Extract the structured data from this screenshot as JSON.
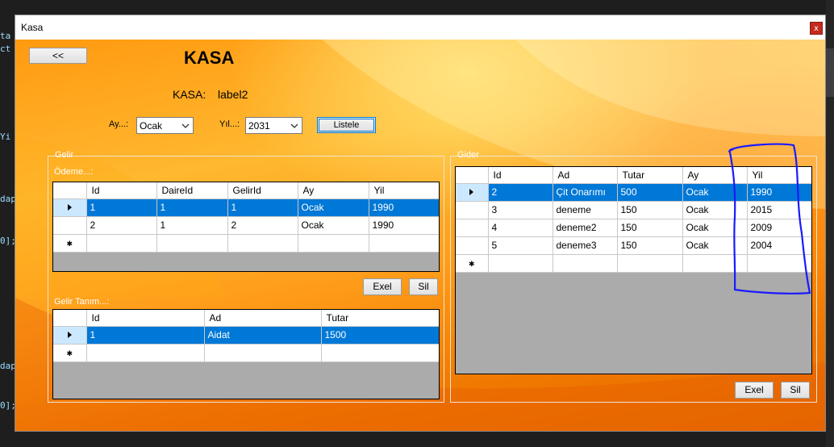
{
  "background_code": {
    "lines": [
      "ta",
      "ct",
      "Yi",
      "dap",
      "0];",
      "dap",
      "0];"
    ]
  },
  "window": {
    "title": "Kasa",
    "close_glyph": "x"
  },
  "header": {
    "back_button": "<<",
    "heading": "KASA",
    "kasa_label": "KASA:",
    "kasa_value": "label2"
  },
  "filter": {
    "ay_label": "Ay...:",
    "ay_value": "Ocak",
    "yil_label": "Yıl...:",
    "yil_value": "2031",
    "list_button": "Listele"
  },
  "gelir": {
    "group_title": "Gelir",
    "odeme_label": "Ödeme...:",
    "odeme_columns": [
      "Id",
      "DaireId",
      "GelirId",
      "Ay",
      "Yil"
    ],
    "odeme_rows": [
      [
        "1",
        "1",
        "1",
        "Ocak",
        "1990"
      ],
      [
        "2",
        "1",
        "2",
        "Ocak",
        "1990"
      ]
    ],
    "exel_button": "Exel",
    "sil_button": "Sil",
    "tanim_label": "Gelir Tanım...:",
    "tanim_columns": [
      "Id",
      "Ad",
      "Tutar"
    ],
    "tanim_rows": [
      [
        "1",
        "Aidat",
        "1500"
      ]
    ]
  },
  "gider": {
    "group_title": "Gider",
    "columns": [
      "Id",
      "Ad",
      "Tutar",
      "Ay",
      "Yil"
    ],
    "rows": [
      [
        "2",
        "Çit Onarımı",
        "500",
        "Ocak",
        "1990"
      ],
      [
        "3",
        "deneme",
        "150",
        "Ocak",
        "2015"
      ],
      [
        "4",
        "deneme2",
        "150",
        "Ocak",
        "2009"
      ],
      [
        "5",
        "deneme3",
        "150",
        "Ocak",
        "2004"
      ]
    ],
    "exel_button": "Exel",
    "sil_button": "Sil"
  },
  "colors": {
    "selection": "#0078d7",
    "annotation": "#1a1aff"
  }
}
